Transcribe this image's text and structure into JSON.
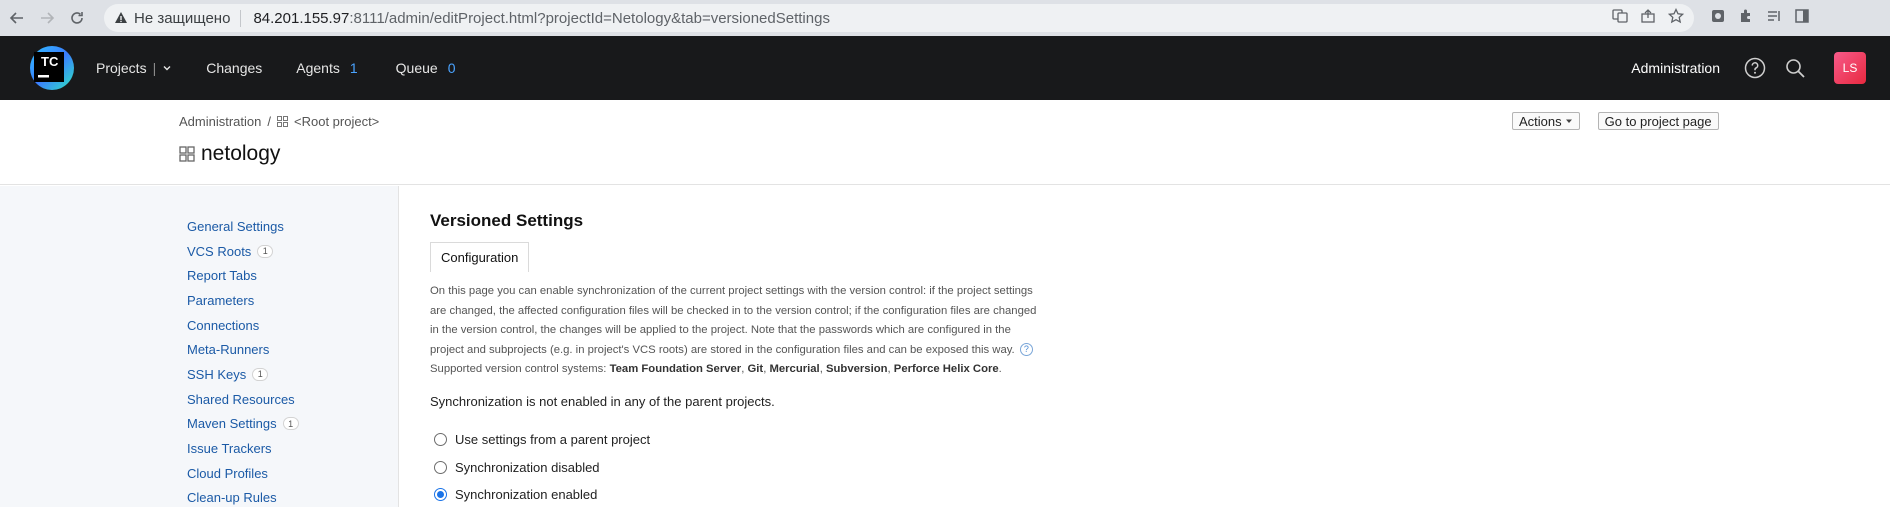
{
  "browser": {
    "security_label": "Не защищено",
    "url_host": "84.201.155.97",
    "url_rest": ":8111/admin/editProject.html?projectId=Netology&tab=versionedSettings"
  },
  "topnav": {
    "logo_text": "TC",
    "projects_label": "Projects",
    "changes_label": "Changes",
    "agents_label": "Agents",
    "agents_count": "1",
    "queue_label": "Queue",
    "queue_count": "0",
    "administration_label": "Administration",
    "avatar_initials": "LS"
  },
  "breadcrumb": {
    "root": "Administration",
    "separator": "/",
    "project": "<Root project>"
  },
  "page": {
    "title": "netology",
    "actions_label": "Actions",
    "goto_label": "Go to project page"
  },
  "sidebar": {
    "items": [
      {
        "label": "General Settings",
        "badge": ""
      },
      {
        "label": "VCS Roots",
        "badge": "1"
      },
      {
        "label": "Report Tabs",
        "badge": ""
      },
      {
        "label": "Parameters",
        "badge": ""
      },
      {
        "label": "Connections",
        "badge": ""
      },
      {
        "label": "Meta-Runners",
        "badge": ""
      },
      {
        "label": "SSH Keys",
        "badge": "1"
      },
      {
        "label": "Shared Resources",
        "badge": ""
      },
      {
        "label": "Maven Settings",
        "badge": "1"
      },
      {
        "label": "Issue Trackers",
        "badge": ""
      },
      {
        "label": "Cloud Profiles",
        "badge": ""
      },
      {
        "label": "Clean-up Rules",
        "badge": ""
      }
    ]
  },
  "main": {
    "section_title": "Versioned Settings",
    "tab_label": "Configuration",
    "description_line1": "On this page you can enable synchronization of the current project settings with the version control: if the project settings",
    "description_line2": "are changed, the affected configuration files will be checked in to the version control; if the configuration files are changed",
    "description_line3": "in the version control, the changes will be applied to the project. Note that the passwords which are configured in the",
    "description_line4": "project and subprojects (e.g. in project's VCS roots) are stored in the configuration files and can be exposed this way.",
    "supported_prefix": "Supported version control systems:",
    "vcs1": "Team Foundation Server",
    "vcs2": "Git",
    "vcs3": "Mercurial",
    "vcs4": "Subversion",
    "vcs5": "Perforce Helix Core",
    "parent_note": "Synchronization is not enabled in any of the parent projects.",
    "radio_options": [
      {
        "label": "Use settings from a parent project",
        "checked": false
      },
      {
        "label": "Synchronization disabled",
        "checked": false
      },
      {
        "label": "Synchronization enabled",
        "checked": true
      }
    ]
  }
}
